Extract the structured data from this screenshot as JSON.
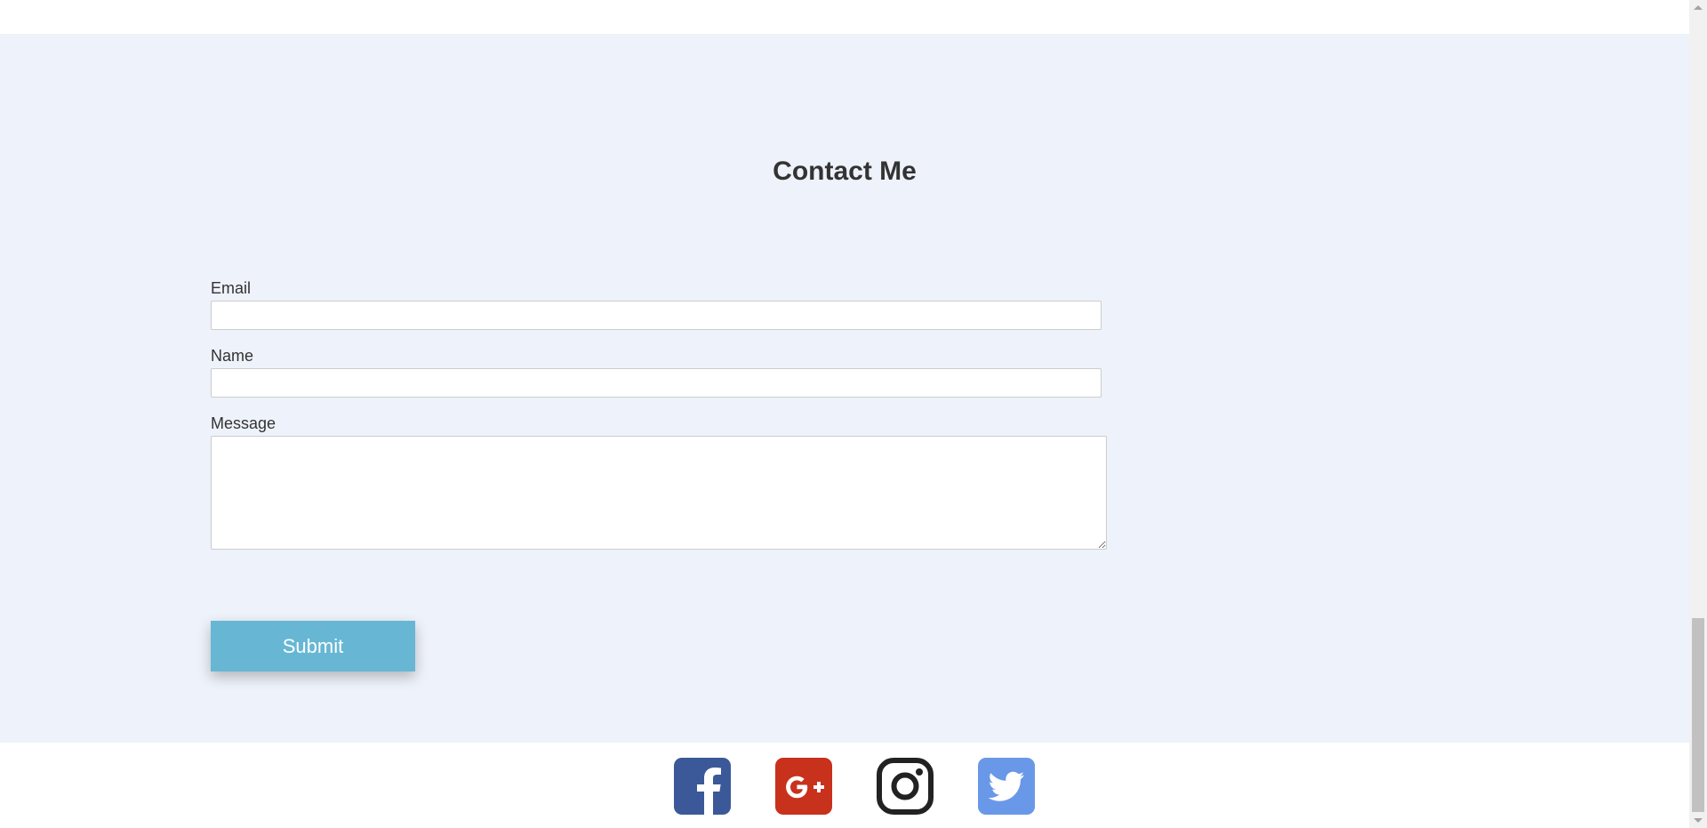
{
  "contact": {
    "title": "Contact Me",
    "email_label": "Email",
    "email_value": "",
    "name_label": "Name",
    "name_value": "",
    "message_label": "Message",
    "message_value": "",
    "submit_label": "Submit"
  },
  "social": [
    {
      "name": "facebook-icon",
      "color": "#3b5998"
    },
    {
      "name": "google-plus-icon",
      "color": "#c8311c"
    },
    {
      "name": "instagram-icon",
      "color": "#222222"
    },
    {
      "name": "twitter-icon",
      "color": "#6a98e8"
    }
  ],
  "colors": {
    "section_bg": "#eef2fa",
    "button_bg": "#67b7d4"
  }
}
